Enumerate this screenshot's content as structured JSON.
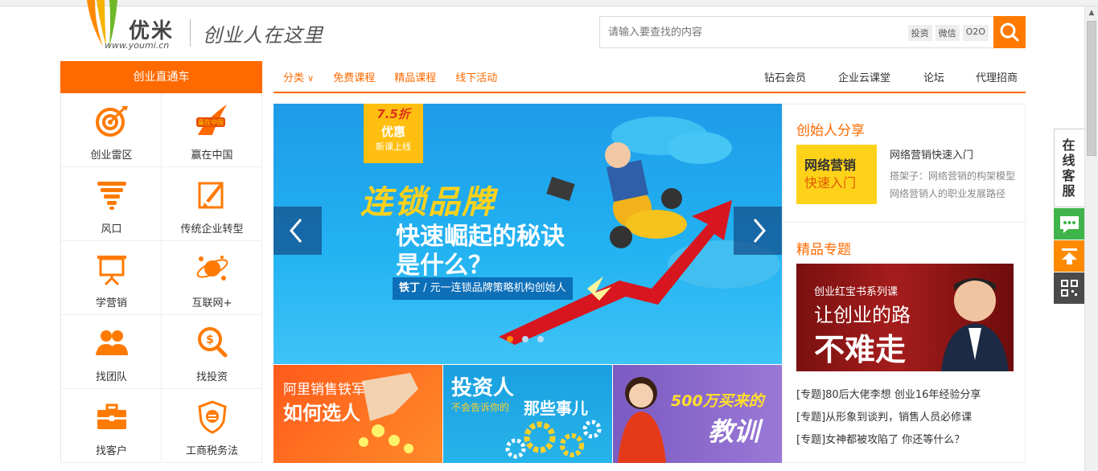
{
  "header": {
    "logo_text": "优米",
    "logo_url": "www.youmi.cn",
    "slogan": "创业人在这里",
    "search_placeholder": "请输入要查找的内容",
    "search_tags": [
      "投资",
      "微信",
      "O2O"
    ]
  },
  "nav": {
    "sidebar_title": "创业直通车",
    "left_items": [
      "分类",
      "免费课程",
      "精品课程",
      "线下活动"
    ],
    "right_items": [
      "钻石会员",
      "企业云课堂",
      "论坛",
      "代理招商"
    ]
  },
  "categories": [
    {
      "label": "创业雷区",
      "icon": "target-icon"
    },
    {
      "label": "赢在中国",
      "icon": "win-in-china-logo"
    },
    {
      "label": "风口",
      "icon": "tornado-icon"
    },
    {
      "label": "传统企业转型",
      "icon": "rocket-icon"
    },
    {
      "label": "学营销",
      "icon": "presentation-board-icon"
    },
    {
      "label": "互联网+",
      "icon": "network-planet-icon"
    },
    {
      "label": "找团队",
      "icon": "team-icon"
    },
    {
      "label": "找投资",
      "icon": "money-search-icon"
    },
    {
      "label": "找客户",
      "icon": "briefcase-icon"
    },
    {
      "label": "工商税务法",
      "icon": "tax-shield-icon"
    }
  ],
  "banner": {
    "badge_discount": "7.5折",
    "badge_title": "优惠",
    "badge_sub": "新课上线",
    "headline_1": "连锁品牌",
    "headline_2": "快速崛起的秘诀",
    "headline_3": "是什么？",
    "speaker_name": "铁丁",
    "speaker_title": "元一连锁品牌策略机构创始人",
    "slide_count": 3,
    "active_slide": 1
  },
  "tiles": [
    {
      "line1": "阿里销售铁军",
      "line2": "如何选人"
    },
    {
      "line1": "投资人",
      "line2": "不会告诉你的",
      "line3": "那些事儿"
    },
    {
      "line1": "500万买来的",
      "line2": "教训"
    }
  ],
  "founder_share": {
    "title": "创始人分享",
    "thumb_line1": "网络营销",
    "thumb_line2": "快速入门",
    "article_title": "网络营销快速入门",
    "article_sub1": "搭架子：网络营销的构架模型",
    "article_sub2": "网络营销人的职业发展路径"
  },
  "premium": {
    "title": "精品专题",
    "banner_series": "创业红宝书系列课",
    "banner_line1": "让创业的路",
    "banner_line2": "不难走",
    "topics": [
      "[专题]80后大佬李想 创业16年经验分享",
      "[专题]从形象到谈判，销售人员必修课",
      "[专题]女神都被攻陷了 你还等什么？"
    ]
  },
  "float_bar": {
    "service_label": "在线客服"
  },
  "colors": {
    "accent": "#ff6a00",
    "banner_blue": "#1ea3ee",
    "green": "#33b34a",
    "dark": "#4a4a4a"
  }
}
